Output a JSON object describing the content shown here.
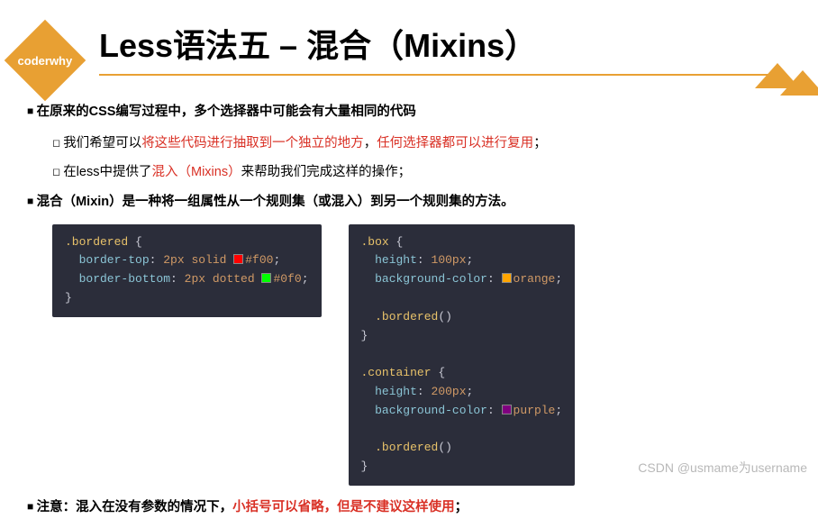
{
  "logo": "coderwhy",
  "title": "Less语法五 – 混合（Mixins）",
  "bullets": {
    "b1": "在原来的CSS编写过程中，多个选择器中可能会有大量相同的代码",
    "b1a_pre": "我们希望可以",
    "b1a_red1": "将这些代码进行抽取到一个独立的地方",
    "b1a_mid": "，",
    "b1a_red2": "任何选择器都可以进行复用",
    "b1a_end": "；",
    "b1b_pre": "在less中提供了",
    "b1b_red": "混入（Mixins）",
    "b1b_end": "来帮助我们完成这样的操作；",
    "b2": "混合（Mixin）是一种将一组属性从一个规则集（或混入）到另一个规则集的方法。",
    "note_pre": "注意：混入在没有参数的情况下，",
    "note_red": "小括号可以省略，但是不建议这样使用",
    "note_end": "；"
  },
  "code": {
    "left": {
      "l1_sel": ".bordered",
      "l1_b": " {",
      "l2_prop": "  border-top",
      "l2_c": ": ",
      "l2_val": "2px solid ",
      "l2_hex": "#f00",
      "l2_e": ";",
      "l3_prop": "  border-bottom",
      "l3_c": ": ",
      "l3_val": "2px dotted ",
      "l3_hex": "#0f0",
      "l3_e": ";",
      "l4": "}"
    },
    "right": {
      "r1_sel": ".box",
      "r1_b": " {",
      "r2_prop": "  height",
      "r2_c": ": ",
      "r2_val": "100px",
      "r2_e": ";",
      "r3_prop": "  background-color",
      "r3_c": ": ",
      "r3_val": "orange",
      "r3_e": ";",
      "blank": "",
      "r4_sel": "  .bordered",
      "r4_p": "()",
      "r5": "}",
      "r6_sel": ".container",
      "r6_b": " {",
      "r7_prop": "  height",
      "r7_c": ": ",
      "r7_val": "200px",
      "r7_e": ";",
      "r8_prop": "  background-color",
      "r8_c": ": ",
      "r8_val": "purple",
      "r8_e": ";",
      "r9_sel": "  .bordered",
      "r9_p": "()",
      "r10": "}"
    }
  },
  "colors": {
    "red": "#f00",
    "green": "#0f0",
    "orange": "orange",
    "purple": "purple"
  },
  "watermark": "CSDN @usmame为username"
}
